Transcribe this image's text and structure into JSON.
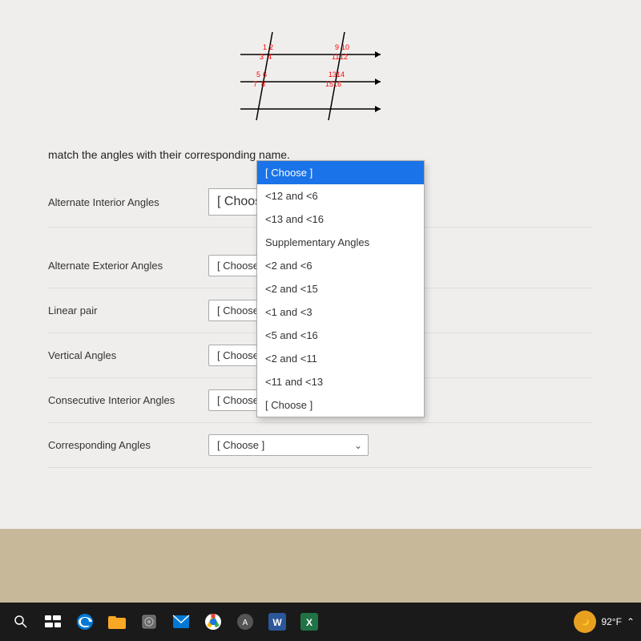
{
  "instruction": "match the angles with their corresponding name.",
  "angle_rows": [
    {
      "label": "Alternate Interior Angles",
      "id": "alternate-interior"
    },
    {
      "label": "Alternate Exterior Angles",
      "id": "alternate-exterior"
    },
    {
      "label": "Linear pair",
      "id": "linear-pair"
    },
    {
      "label": "Vertical Angles",
      "id": "vertical-angles"
    },
    {
      "label": "Consecutive Interior Angles",
      "id": "consecutive-interior"
    },
    {
      "label": "Corresponding Angles",
      "id": "corresponding-angles"
    }
  ],
  "dropdown_options": [
    {
      "value": "choose",
      "label": "[ Choose ]"
    },
    {
      "value": "lt12_lt6",
      "label": "<12 and <6"
    },
    {
      "value": "lt13_lt16",
      "label": "<13 and <16"
    },
    {
      "value": "supplementary",
      "label": "Supplementary Angles"
    },
    {
      "value": "lt2_lt6",
      "label": "<2 and <6"
    },
    {
      "value": "lt2_lt15",
      "label": "<2 and <15"
    },
    {
      "value": "lt1_lt3",
      "label": "<1 and <3"
    },
    {
      "value": "lt5_lt16",
      "label": "<5 and <16"
    },
    {
      "value": "lt2_lt11",
      "label": "<2 and <11"
    },
    {
      "value": "lt11_lt13",
      "label": "<11 and <13"
    }
  ],
  "open_dropdown_header": "[ Choose ]",
  "open_dropdown_selected": "[ Choose ]",
  "taskbar": {
    "temperature": "92°F",
    "icons": [
      "search",
      "taskview",
      "edge",
      "explorer",
      "vault",
      "email",
      "chrome",
      "appicon",
      "word",
      "excel"
    ]
  }
}
